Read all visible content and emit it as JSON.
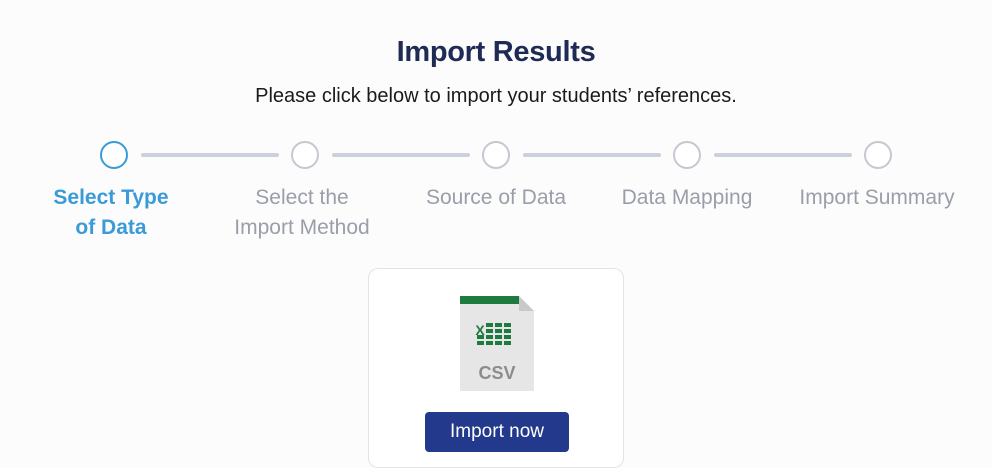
{
  "header": {
    "title": "Import Results",
    "subtitle": "Please click below to import your students’ references."
  },
  "steps": [
    {
      "line1": "Select Type",
      "line2": "of Data",
      "active": true
    },
    {
      "line1": "Select the",
      "line2": "Import Method",
      "active": false
    },
    {
      "line1": "Source of Data",
      "line2": "",
      "active": false
    },
    {
      "line1": "Data Mapping",
      "line2": "",
      "active": false
    },
    {
      "line1": "Import Summary",
      "line2": "",
      "active": false
    }
  ],
  "card": {
    "file_type_label": "CSV",
    "file_badge": "X",
    "button_label": "Import now"
  },
  "colors": {
    "active_step": "#3b9bd8",
    "inactive_step": "#9a9ea8",
    "title": "#1f2a55",
    "button": "#233a8c",
    "excel_green": "#1e7a3e"
  }
}
